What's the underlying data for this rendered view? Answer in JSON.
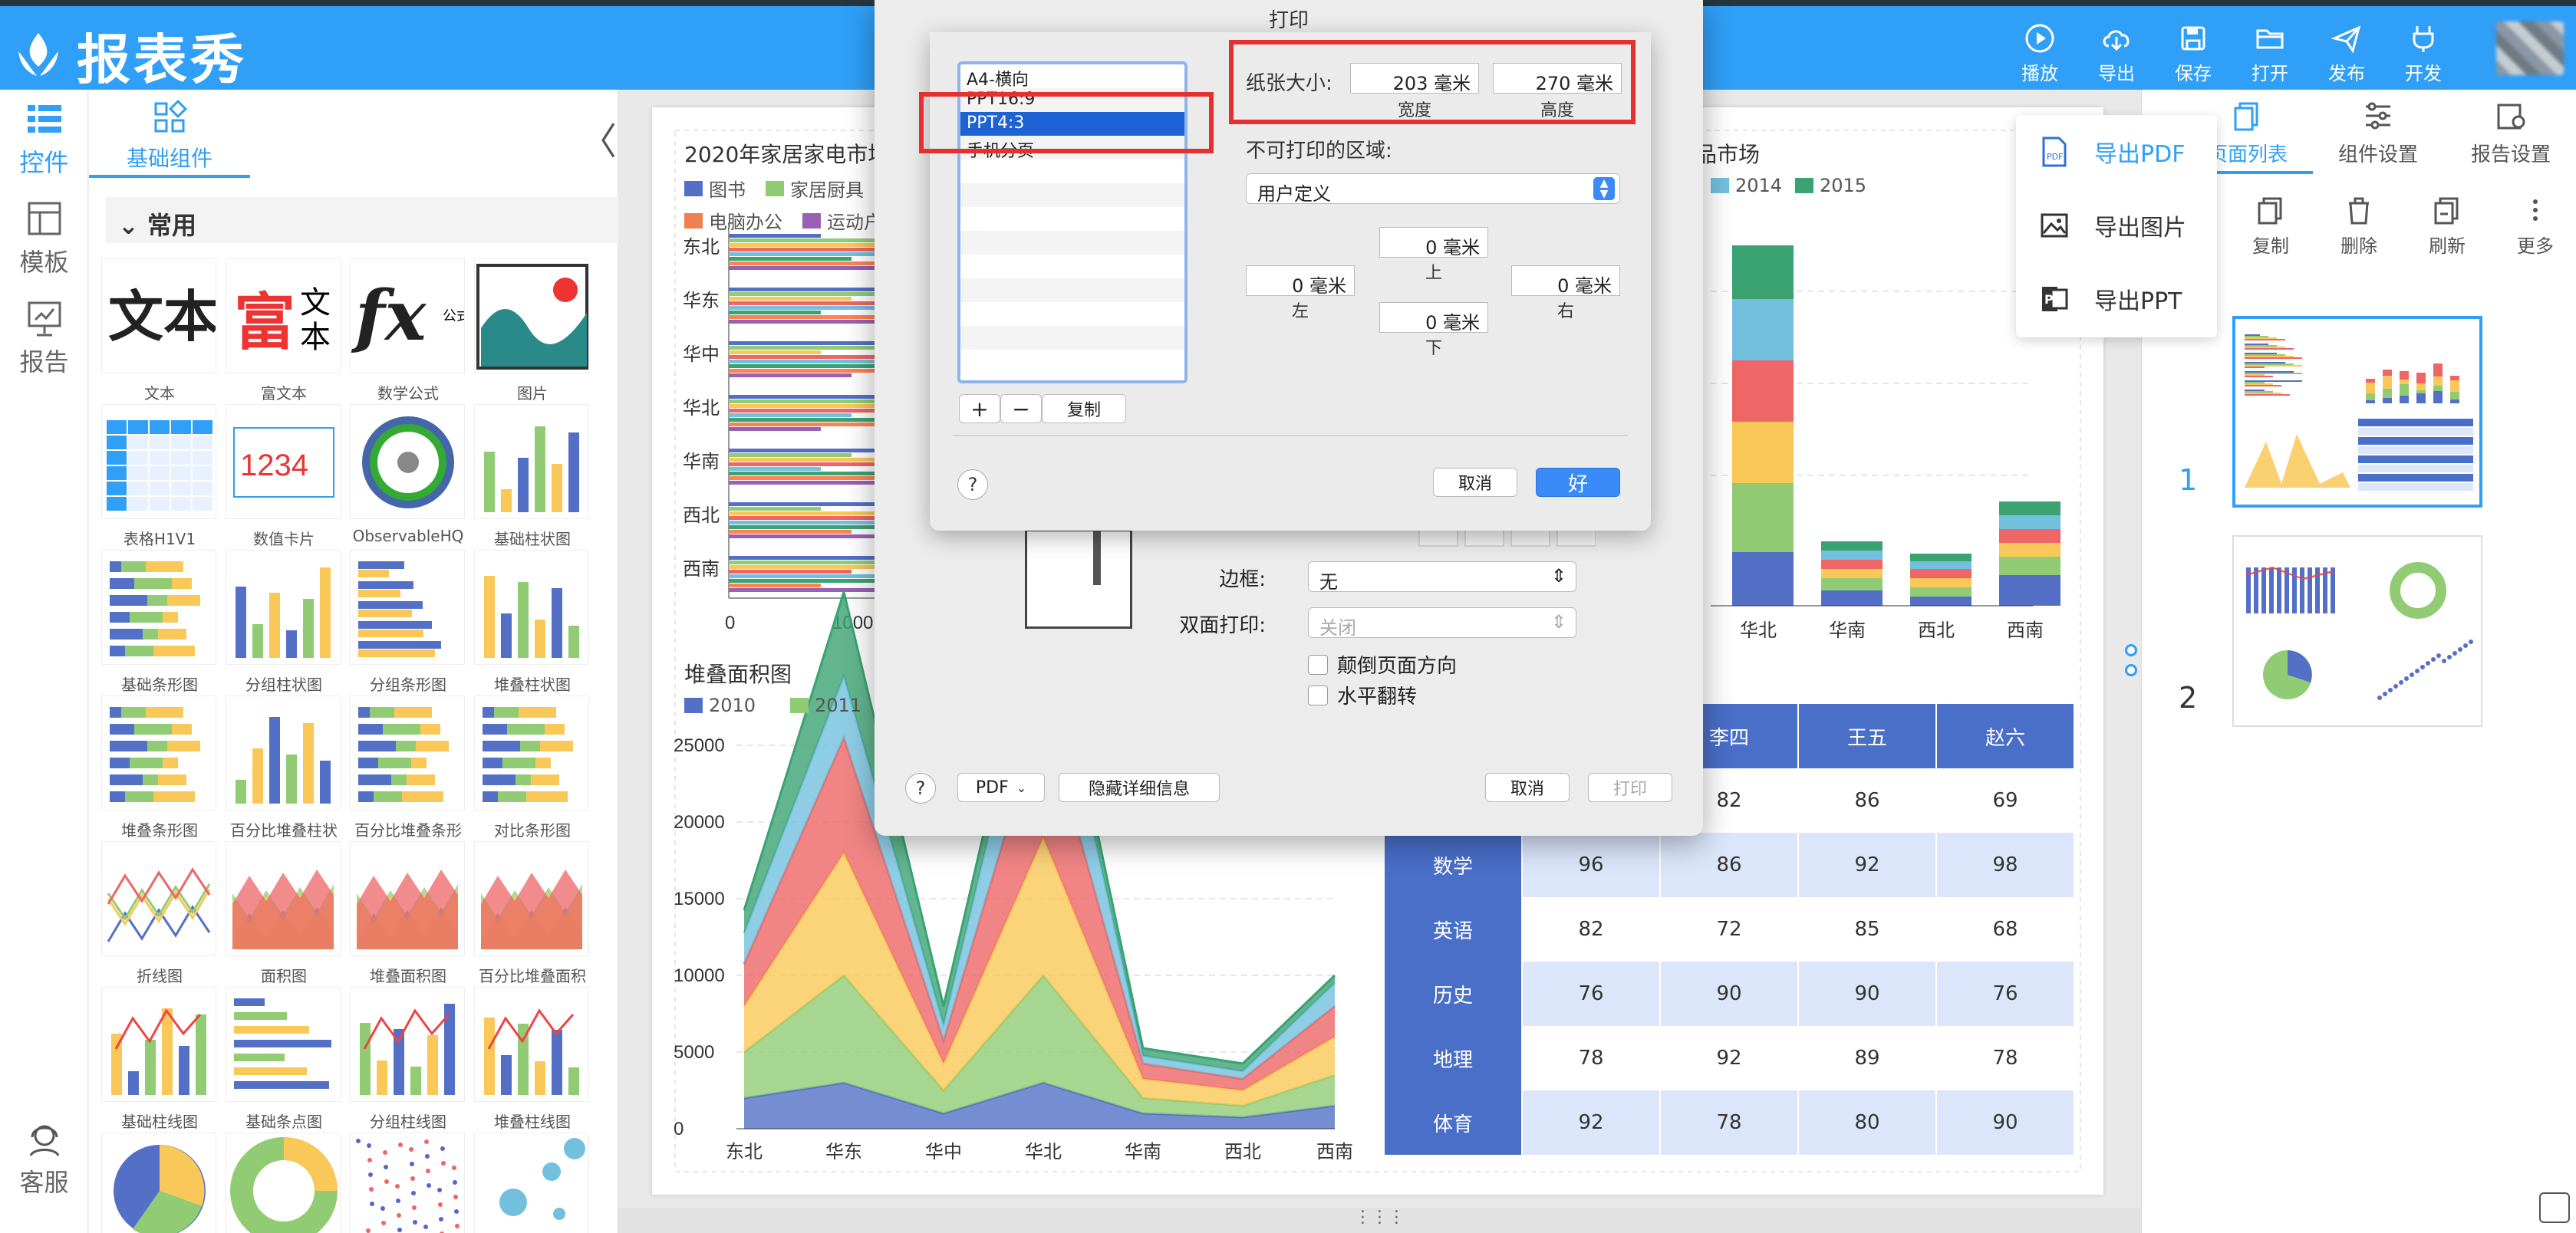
{
  "app": {
    "title": "报表秀"
  },
  "toolbar": {
    "items": [
      {
        "label": "播放",
        "icon": "play-icon"
      },
      {
        "label": "导出",
        "icon": "cloud-download-icon"
      },
      {
        "label": "保存",
        "icon": "save-icon"
      },
      {
        "label": "打开",
        "icon": "folder-icon"
      },
      {
        "label": "发布",
        "icon": "send-icon"
      },
      {
        "label": "开发",
        "icon": "plug-icon"
      }
    ]
  },
  "leftnav": {
    "items": [
      "控件",
      "模板",
      "报告"
    ],
    "bottom": "客服"
  },
  "panel": {
    "tab": "基础组件",
    "section": "常用",
    "components": [
      "文本",
      "富文本",
      "数学公式",
      "图片",
      "表格H1V1",
      "数值卡片",
      "ObservableHQ",
      "基础柱状图",
      "基础条形图",
      "分组柱状图",
      "分组条形图",
      "堆叠柱状图",
      "堆叠条形图",
      "百分比堆叠柱状图",
      "百分比堆叠条形图",
      "对比条形图",
      "折线图",
      "面积图",
      "堆叠面积图",
      "百分比堆叠面积图",
      "基础柱线图",
      "基础条点图",
      "分组柱线图",
      "堆叠柱线图"
    ],
    "thumb_text": {
      "text": "文本",
      "rich1": "富",
      "rich2": "文",
      "rich3": "本",
      "fx": "fx",
      "fx_small": "公式",
      "card": "1234"
    }
  },
  "report": {
    "chart1": {
      "title": "2020年家居家电市场",
      "legend": [
        "图书",
        "家居厨具",
        "电脑办公",
        "运动户"
      ],
      "categories": [
        "东北",
        "华东",
        "华中",
        "华北",
        "华南",
        "西北",
        "西南"
      ],
      "xticks": [
        "0",
        "1000"
      ]
    },
    "chart2": {
      "title": "品市场",
      "legend": [
        "2014",
        "2015"
      ],
      "categories": [
        "华北",
        "华南",
        "西北",
        "西南"
      ]
    },
    "chart3": {
      "title": "堆叠面积图",
      "legend": [
        "2010",
        "2011"
      ],
      "yticks": [
        "25000",
        "20000",
        "15000",
        "10000",
        "5000",
        "0"
      ],
      "categories": [
        "东北",
        "华东",
        "华中",
        "华北",
        "华南",
        "西北",
        "西南"
      ]
    },
    "table": {
      "headers": [
        "李四",
        "王五",
        "赵六"
      ],
      "rows": [
        {
          "subject": "",
          "values": [
            "82",
            "86",
            "69"
          ]
        },
        {
          "subject": "数学",
          "values": [
            "96",
            "86",
            "92",
            "98"
          ]
        },
        {
          "subject": "英语",
          "values": [
            "82",
            "72",
            "85",
            "68"
          ]
        },
        {
          "subject": "历史",
          "values": [
            "76",
            "90",
            "90",
            "76"
          ]
        },
        {
          "subject": "地理",
          "values": [
            "78",
            "92",
            "89",
            "78"
          ]
        },
        {
          "subject": "体育",
          "values": [
            "92",
            "78",
            "80",
            "90"
          ]
        }
      ]
    }
  },
  "rightpanel": {
    "tabs": [
      "页面列表",
      "组件设置",
      "报告设置"
    ],
    "tools": [
      "复制",
      "删除",
      "刷新",
      "更多"
    ],
    "pages": [
      "1",
      "2"
    ]
  },
  "export_menu": {
    "items": [
      "导出PDF",
      "导出图片",
      "导出PPT"
    ]
  },
  "print_dialog": {
    "title": "打印",
    "border_label": "边框:",
    "border_value": "无",
    "duplex_label": "双面打印:",
    "duplex_value": "关闭",
    "checkbox1": "颠倒页面方向",
    "checkbox2": "水平翻转",
    "pdf": "PDF",
    "details": "隐藏详细信息",
    "cancel": "取消",
    "print": "打印",
    "help": "?"
  },
  "paper_sheet": {
    "presets": [
      "A4-横向",
      "PPT16:9",
      "PPT4:3",
      "手机分页"
    ],
    "selected": "PPT4:3",
    "add": "+",
    "remove": "−",
    "duplicate": "复制",
    "paper_size_label": "纸张大小:",
    "width_value": "203 毫米",
    "height_value": "270 毫米",
    "width_label": "宽度",
    "height_label": "高度",
    "nonprint_label": "不可打印的区域:",
    "nonprint_value": "用户定义",
    "top_value": "0 毫米",
    "top_label": "上",
    "left_value": "0 毫米",
    "left_label": "左",
    "right_value": "0 毫米",
    "right_label": "右",
    "bottom_value": "0 毫米",
    "bottom_label": "下",
    "help": "?",
    "cancel": "取消",
    "ok": "好"
  }
}
